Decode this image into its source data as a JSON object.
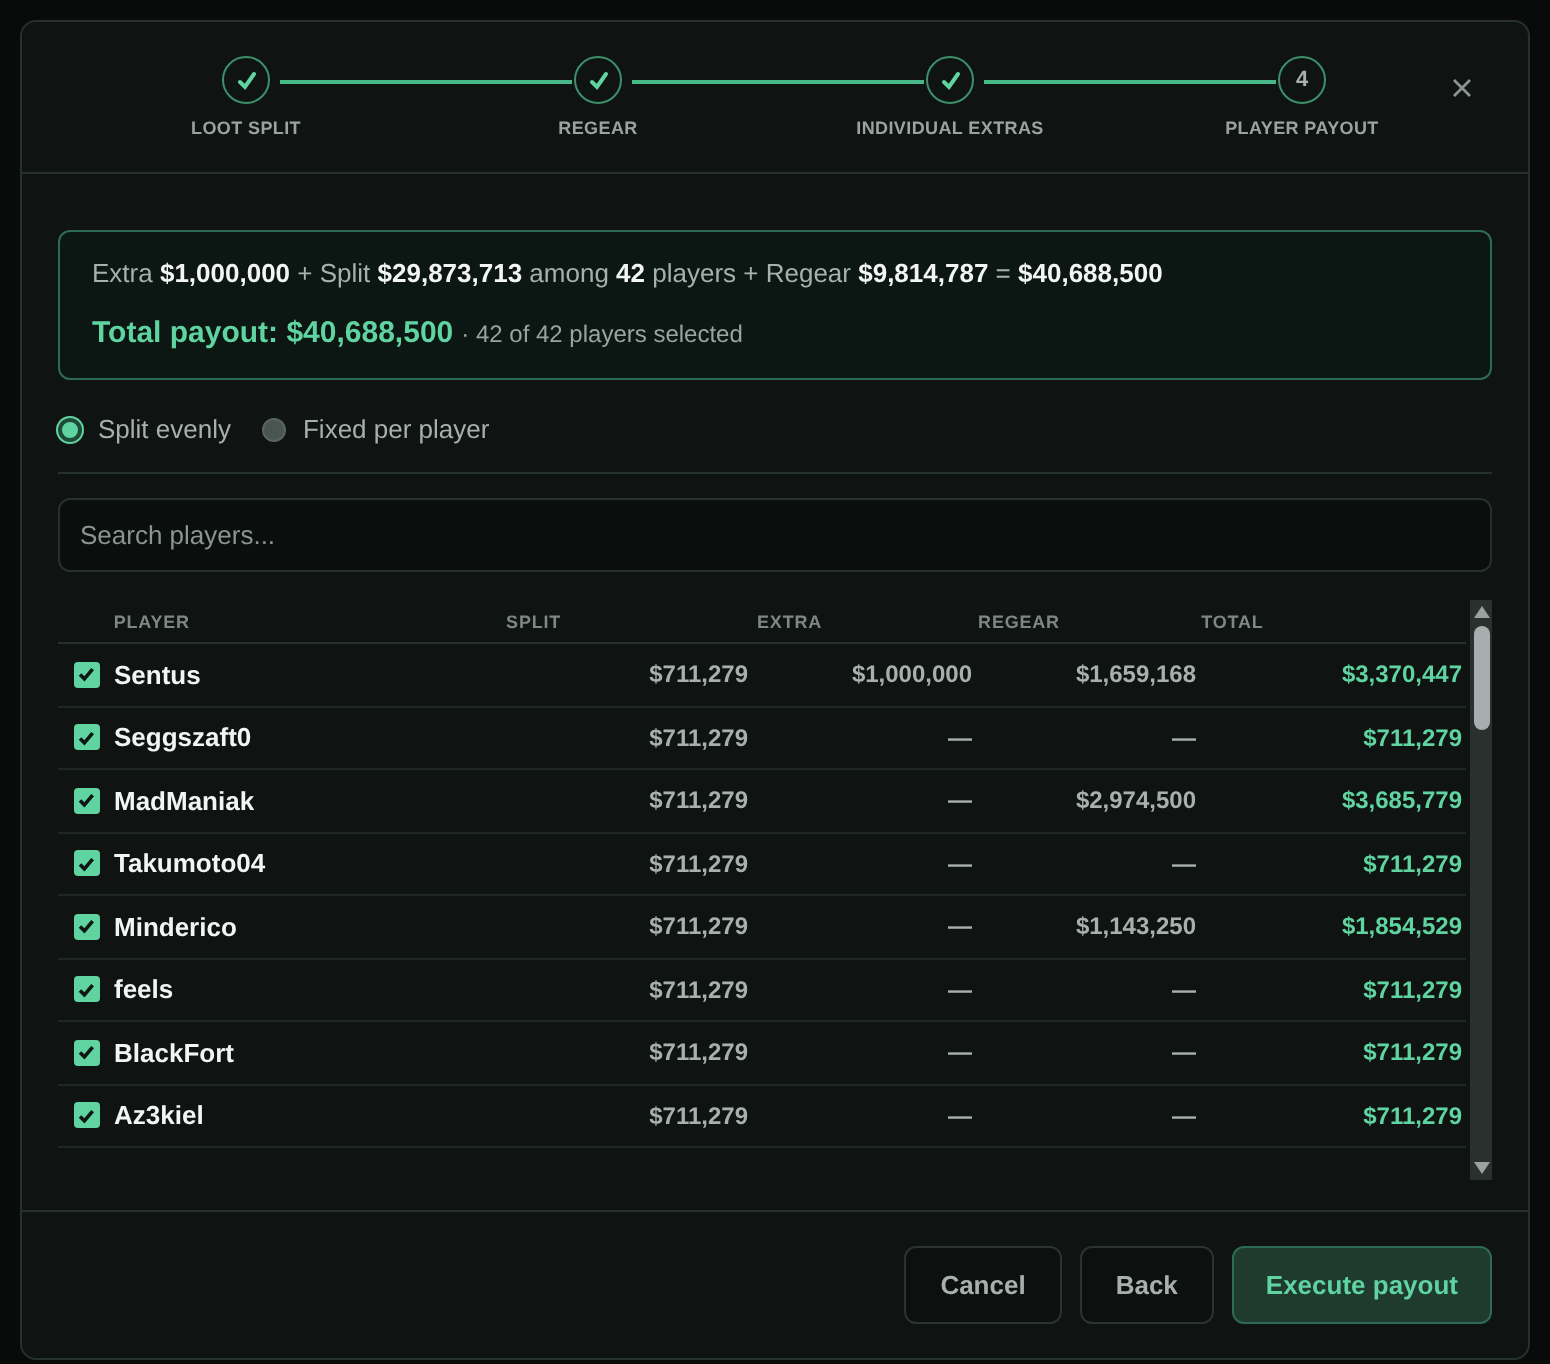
{
  "steps": [
    {
      "label": "LOOT SPLIT",
      "done": true
    },
    {
      "label": "REGEAR",
      "done": true
    },
    {
      "label": "INDIVIDUAL EXTRAS",
      "done": true
    },
    {
      "label": "PLAYER PAYOUT",
      "number": "4",
      "done": false
    }
  ],
  "summary": {
    "formula": "Extra **$1,000,000** + Split **$29,873,713** among **42** players + Regear **$9,814,787** = **$40,688,500**",
    "total": "Total payout: $40,688,500",
    "selected_count": "· 42 of 42 players selected"
  },
  "modes": [
    {
      "label": "Split evenly",
      "selected": true
    },
    {
      "label": "Fixed per player",
      "selected": false
    }
  ],
  "search": {
    "placeholder": "Search players..."
  },
  "table": {
    "columns": [
      "PLAYER",
      "SPLIT",
      "EXTRA",
      "REGEAR",
      "TOTAL"
    ],
    "rows": [
      {
        "checked": true,
        "player": "Sentus",
        "split": "$711,279",
        "extra": "$1,000,000",
        "regear": "$1,659,168",
        "total": "$3,370,447"
      },
      {
        "checked": true,
        "player": "Seggszaft0",
        "split": "$711,279",
        "extra": "—",
        "regear": "—",
        "total": "$711,279"
      },
      {
        "checked": true,
        "player": "MadManiak",
        "split": "$711,279",
        "extra": "—",
        "regear": "$2,974,500",
        "total": "$3,685,779"
      },
      {
        "checked": true,
        "player": "Takumoto04",
        "split": "$711,279",
        "extra": "—",
        "regear": "—",
        "total": "$711,279"
      },
      {
        "checked": true,
        "player": "Minderico",
        "split": "$711,279",
        "extra": "—",
        "regear": "$1,143,250",
        "total": "$1,854,529"
      },
      {
        "checked": true,
        "player": "feels",
        "split": "$711,279",
        "extra": "—",
        "regear": "—",
        "total": "$711,279"
      },
      {
        "checked": true,
        "player": "BlackFort",
        "split": "$711,279",
        "extra": "—",
        "regear": "—",
        "total": "$711,279"
      },
      {
        "checked": true,
        "player": "Az3kiel",
        "split": "$711,279",
        "extra": "—",
        "regear": "—",
        "total": "$711,279"
      }
    ]
  },
  "buttons": [
    {
      "label": "Cancel",
      "kind": "secondary"
    },
    {
      "label": "Back",
      "kind": "secondary"
    },
    {
      "label": "Execute payout",
      "kind": "primary"
    }
  ]
}
